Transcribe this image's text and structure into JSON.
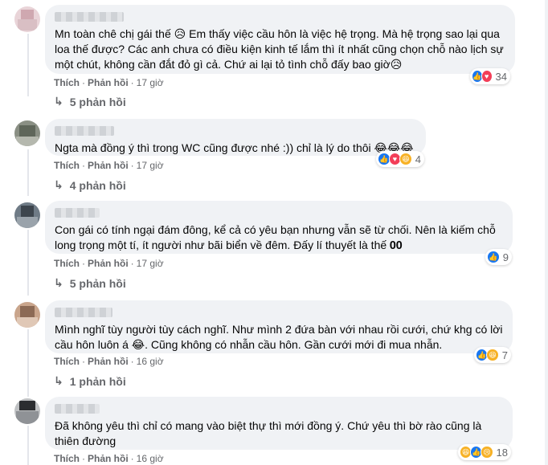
{
  "comments": [
    {
      "text": "Mn toàn chê chị gái thế 😥 Em thấy việc cầu hôn là việc hệ trọng. Mà hệ trọng sao lại qua loa thế được? Các anh chưa có điều kiện kinh tế lắm thì ít nhất cũng chọn chỗ nào lịch sự một chút, không cần đắt đỏ gì cả. Chứ ai lại tỏ tình chỗ đấy bao giờ😥",
      "like_label": "Thích",
      "reply_label": "Phản hồi",
      "time": "17 giờ",
      "reaction_count": "34",
      "reaction_icons": [
        "like-icon",
        "love-icon"
      ],
      "replies_label": "5 phản hồi"
    },
    {
      "text": "Ngta mà đồng ý thì trong WC cũng được nhé :)) chỉ là lý do thôi 😂😂😂",
      "like_label": "Thích",
      "reply_label": "Phản hồi",
      "time": "17 giờ",
      "reaction_count": "4",
      "reaction_icons": [
        "like-icon",
        "love-icon",
        "haha-icon"
      ],
      "replies_label": "4 phản hồi"
    },
    {
      "text": "Con gái có tính ngại đám đông, kể cả có yêu bạn nhưng vẫn sẽ từ chối. Nên là kiếm chỗ long trọng một tí, ít người như bãi biển về đêm. Đấy lí thuyết là thế 𝟎𝟎",
      "like_label": "Thích",
      "reply_label": "Phản hồi",
      "time": "17 giờ",
      "reaction_count": "9",
      "reaction_icons": [
        "like-icon"
      ],
      "replies_label": "5 phản hồi"
    },
    {
      "text": "Mình nghĩ tùy người tùy cách nghĩ. Như mình 2 đứa bàn với nhau rồi cưới, chứ khg có lời cầu hôn luôn á 😂. Cũng không có nhẫn cầu hôn. Gần cưới mới đi mua nhẫn.",
      "like_label": "Thích",
      "reply_label": "Phản hồi",
      "time": "16 giờ",
      "reaction_count": "7",
      "reaction_icons": [
        "like-icon",
        "haha-icon"
      ],
      "replies_label": "1 phản hồi"
    },
    {
      "text": "Đã không yêu thì chỉ có mang vào biệt thự thì mới đồng ý. Chứ yêu thì bờ rào cũng là thiên đường",
      "like_label": "Thích",
      "reply_label": "Phản hồi",
      "time": "16 giờ",
      "reaction_count": "18",
      "reaction_icons": [
        "haha-icon",
        "like-icon",
        "sad-icon"
      ],
      "replies_label": ""
    }
  ],
  "colors": {
    "bubble": "#f0f2f5",
    "muted": "#65676b",
    "like": "#1877f2",
    "love": "#f33e58",
    "haha": "#f7b125"
  }
}
